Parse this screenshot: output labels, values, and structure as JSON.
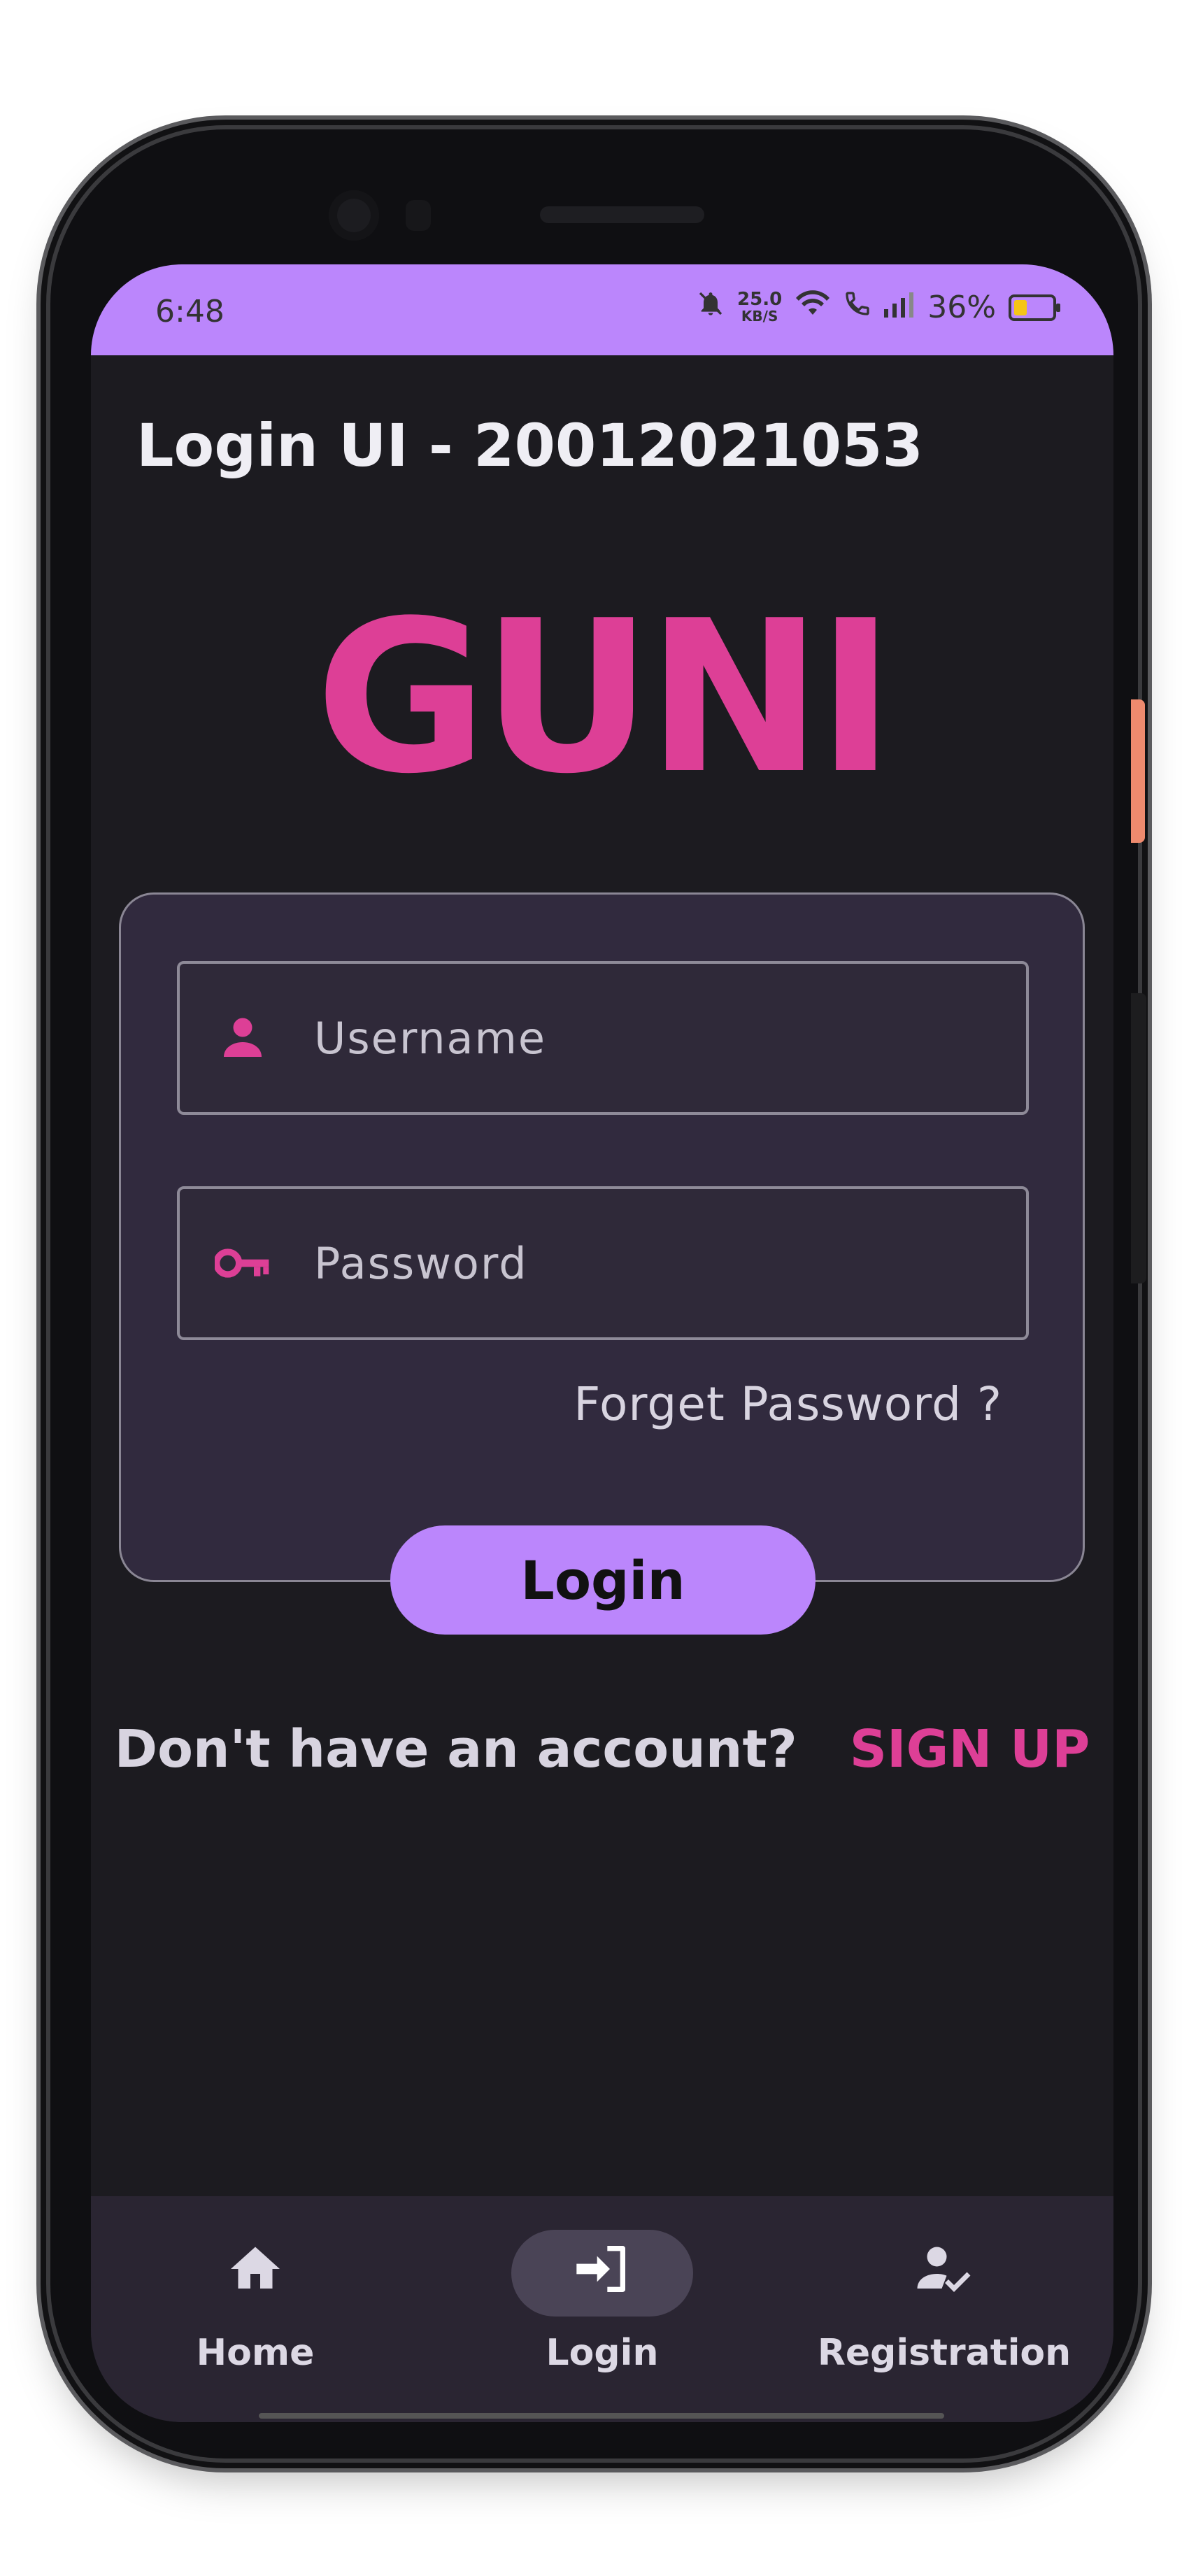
{
  "status_bar": {
    "time": "6:48",
    "net_speed_value": "25.0",
    "net_speed_unit": "KB/S",
    "battery_text": "36%",
    "icons": [
      "mute-bell-icon",
      "wifi-icon",
      "wifi-call-icon",
      "signal-icon",
      "battery-icon"
    ]
  },
  "app": {
    "title": "Login UI - 20012021053",
    "brand": "GUNI"
  },
  "form": {
    "username_placeholder": "Username",
    "username_value": "",
    "password_placeholder": "Password",
    "password_value": "",
    "forget_password": "Forget Password ?",
    "login_button": "Login"
  },
  "signup": {
    "question": "Don't have an account?",
    "link": "SIGN UP"
  },
  "bottom_nav": {
    "items": [
      {
        "label": "Home",
        "icon": "home-icon",
        "active": false
      },
      {
        "label": "Login",
        "icon": "login-icon",
        "active": true
      },
      {
        "label": "Registration",
        "icon": "person-check-icon",
        "active": false
      }
    ]
  },
  "colors": {
    "accent": "#bb86fc",
    "brand_pink": "#dd3f96",
    "background": "#1c1b20",
    "card": "#312a3e"
  }
}
